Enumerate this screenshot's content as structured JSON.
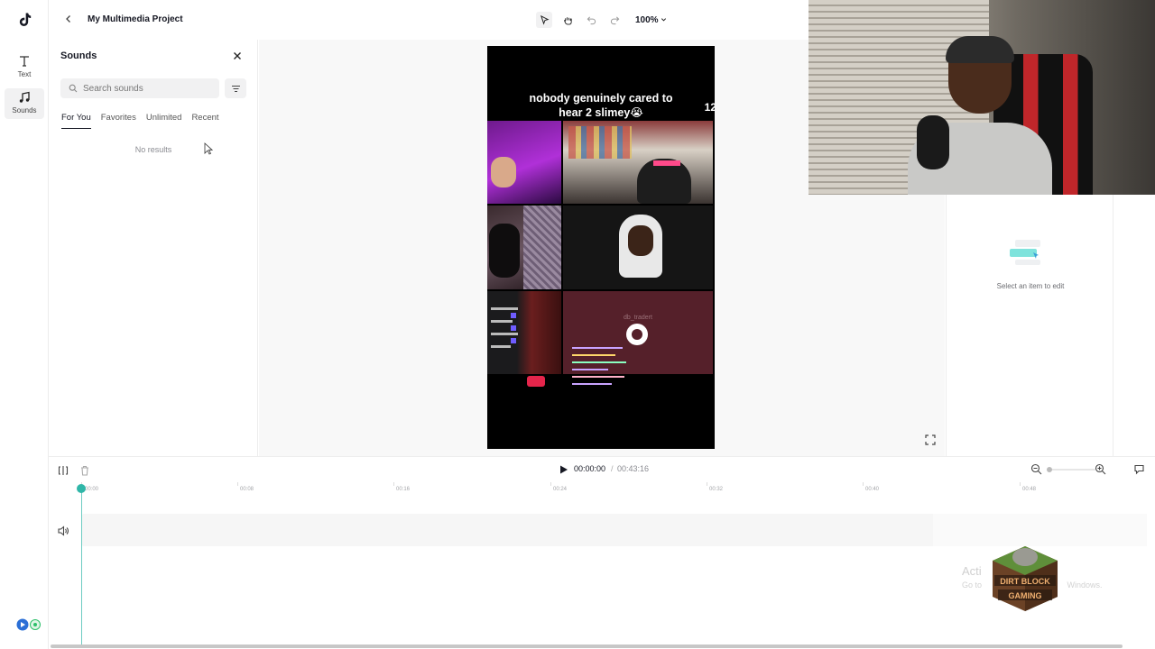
{
  "header": {
    "project_title": "My Multimedia Project",
    "zoom_level": "100%"
  },
  "rail": {
    "items": [
      {
        "label": "Text",
        "icon": "text-icon"
      },
      {
        "label": "Sounds",
        "icon": "music-note-icon",
        "active": true
      }
    ]
  },
  "sounds_panel": {
    "title": "Sounds",
    "search_placeholder": "Search sounds",
    "tabs": [
      "For You",
      "Favorites",
      "Unlimited",
      "Recent"
    ],
    "active_tab": "For You",
    "empty_message": "No results"
  },
  "preview": {
    "caption_line1": "nobody genuinely cared to",
    "caption_line2": "hear 2 slimey😭",
    "caption_overflow": "12",
    "tile_label_stream": "db_tradert"
  },
  "inspector": {
    "message": "Select an item to edit"
  },
  "timeline": {
    "current_time": "00:00:00",
    "separator": "/",
    "total_time": "00:43:16",
    "ruler_ticks": [
      "00:00",
      "00:08",
      "00:16",
      "00:24",
      "00:32",
      "00:40",
      "00:48"
    ]
  },
  "overlay": {
    "activate_title": "Acti",
    "activate_sub": "Go to",
    "activate_sub_end": "Windows.",
    "brand_text": "DIRT BLOCK GAMING"
  },
  "colors": {
    "accent_teal": "#2fb6a8",
    "text_primary": "#161823",
    "text_muted": "#8a8b91",
    "end_call_red": "#e5254b"
  }
}
